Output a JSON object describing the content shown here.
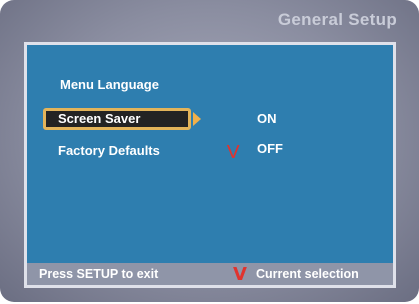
{
  "header": {
    "title": "General Setup"
  },
  "menu": {
    "items": [
      {
        "label": "Menu Language"
      },
      {
        "label": "Screen Saver"
      },
      {
        "label": "Factory Defaults"
      }
    ]
  },
  "options": {
    "on_label": "ON",
    "off_label": "OFF",
    "selected_mark": "V"
  },
  "footer": {
    "hint": "Press SETUP to exit",
    "legend_mark": "V",
    "legend_label": "Current selection"
  },
  "colors": {
    "panel": "#2e7eaf",
    "highlight_border": "#e3b45a",
    "check_mark": "#e0332e",
    "footer": "#8f95a8"
  }
}
